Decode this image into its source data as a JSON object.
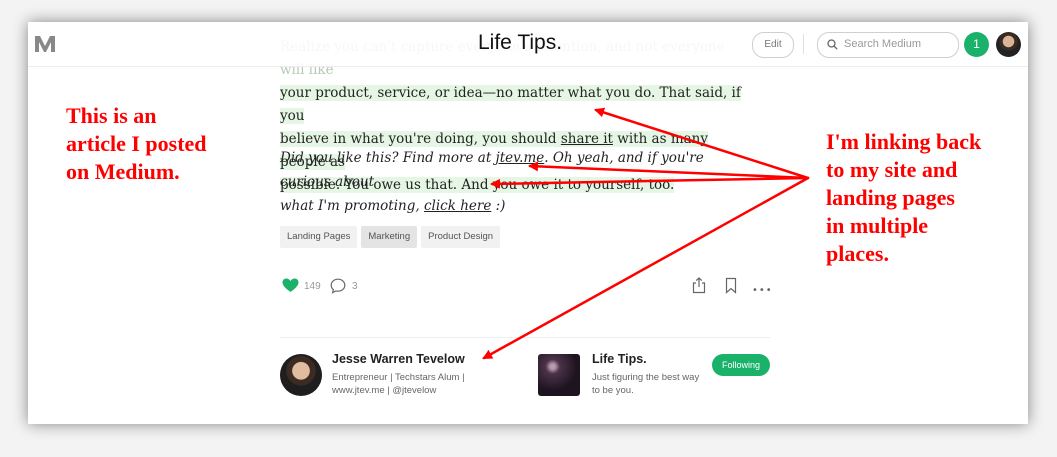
{
  "header": {
    "publication_title": "Life Tips.",
    "edit_label": "Edit",
    "search_placeholder": "Search Medium",
    "notification_count": "1"
  },
  "article": {
    "para1_line1_faded": "Realize you can't capture everyone's attention, and not everyone will like",
    "para1_line2": "your product, service, or idea—no matter what you do. That said, if you",
    "para1_line3_a": "believe in what you're doing, you should ",
    "para1_line3_link": "share it",
    "para1_line3_b": " with as many people as",
    "para1_line4": "possible. You owe us that. And you owe it to yourself, too.",
    "para2_a": "Did you like this? Find more at ",
    "para2_link1": "jtev.me",
    "para2_b": ". Oh yeah, and if you're curious about",
    "para2_c": "what I'm promoting, ",
    "para2_link2": "click here",
    "para2_d": " :)"
  },
  "tags": [
    "Landing Pages",
    "Marketing",
    "Product Design"
  ],
  "actions": {
    "likes": "149",
    "comments": "3",
    "more": "•••"
  },
  "author": {
    "name": "Jesse Warren Tevelow",
    "bio": "Entrepreneur | Techstars Alum | www.jtev.me | @jtevelow"
  },
  "publication": {
    "name": "Life Tips.",
    "description": "Just figuring the best way to be you.",
    "follow_label": "Following"
  },
  "annotations": {
    "left": "This is an\narticle I posted\non Medium.",
    "right": "I'm linking back\nto my site and\nlanding pages\nin multiple\nplaces."
  },
  "colors": {
    "accent_green": "#1ab26b",
    "annotation_red": "#ff0000",
    "highlight": "#e5f6e5"
  }
}
